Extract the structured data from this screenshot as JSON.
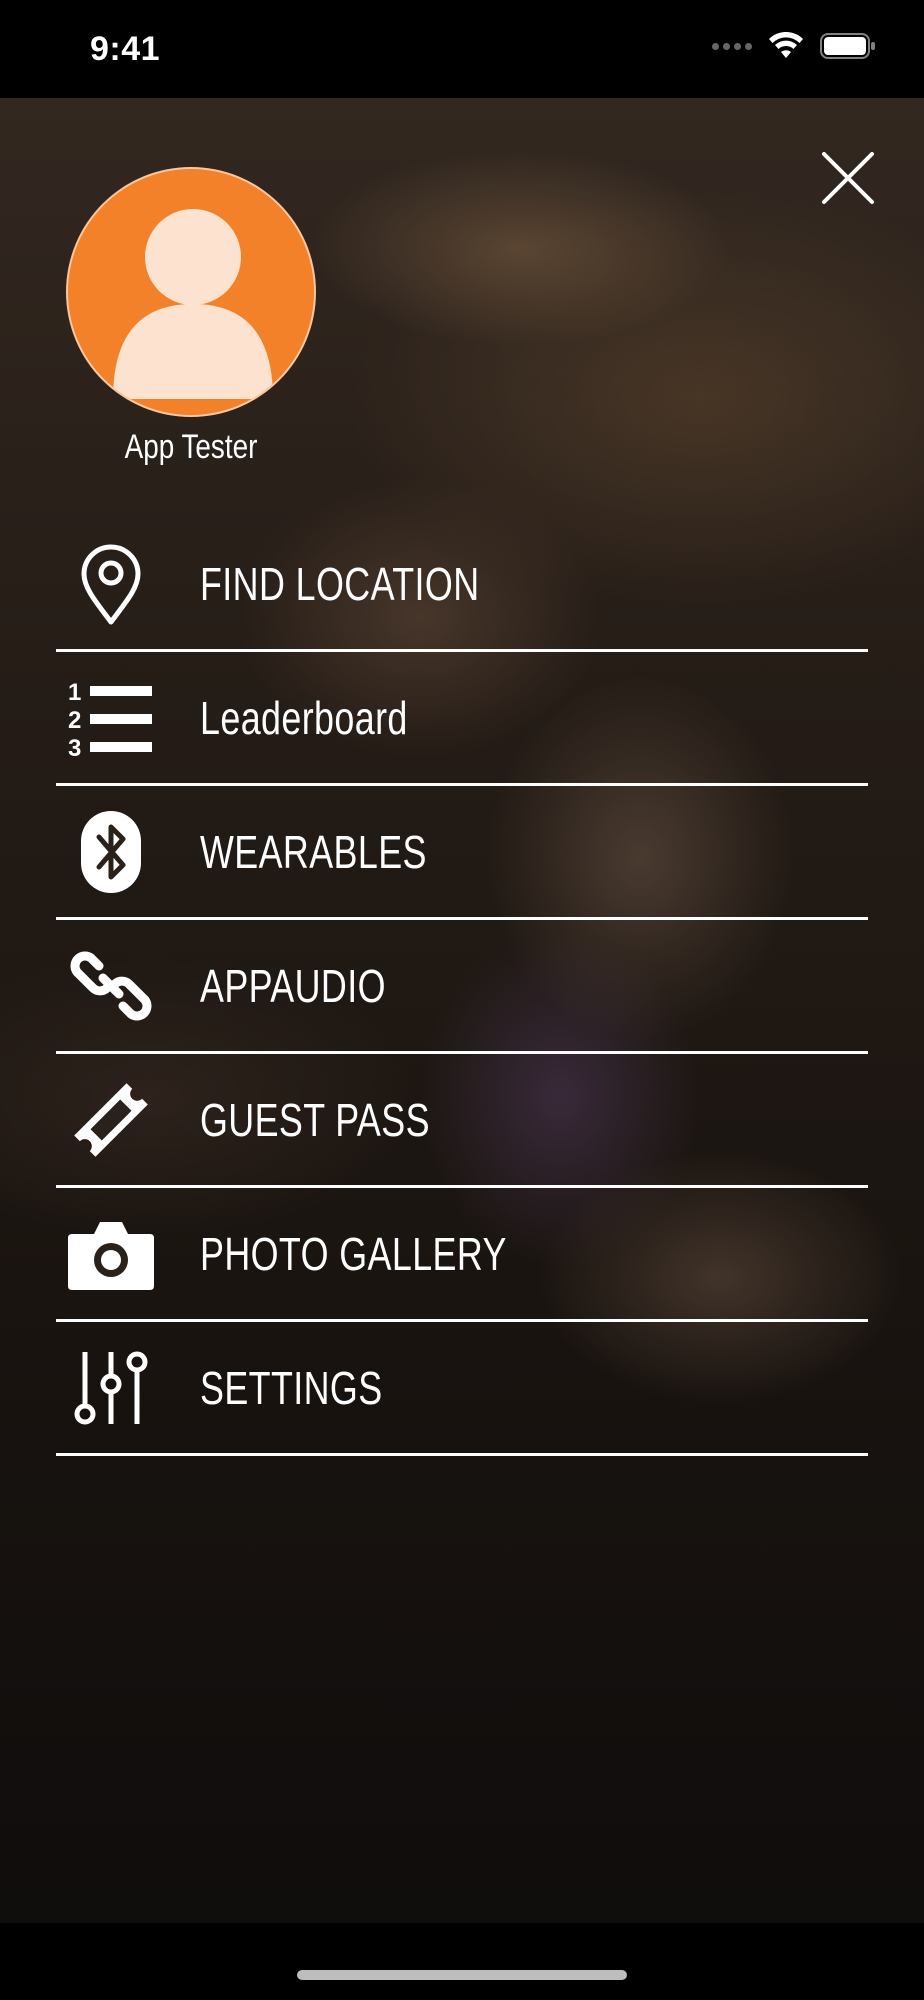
{
  "status_bar": {
    "time": "9:41"
  },
  "profile": {
    "name": "App Tester",
    "avatar_color": "#f38129",
    "avatar_figure_color": "#fde3cf"
  },
  "menu": {
    "items": [
      {
        "label": "FIND LOCATION",
        "icon": "location-pin-icon"
      },
      {
        "label": "Leaderboard",
        "icon": "numbered-list-icon"
      },
      {
        "label": "WEARABLES",
        "icon": "bluetooth-icon"
      },
      {
        "label": "APPAUDIO",
        "icon": "link-icon"
      },
      {
        "label": "GUEST PASS",
        "icon": "ticket-icon"
      },
      {
        "label": "PHOTO GALLERY",
        "icon": "camera-icon"
      },
      {
        "label": "SETTINGS",
        "icon": "sliders-icon"
      }
    ]
  },
  "colors": {
    "divider": "#ffffff",
    "text": "#ffffff"
  }
}
